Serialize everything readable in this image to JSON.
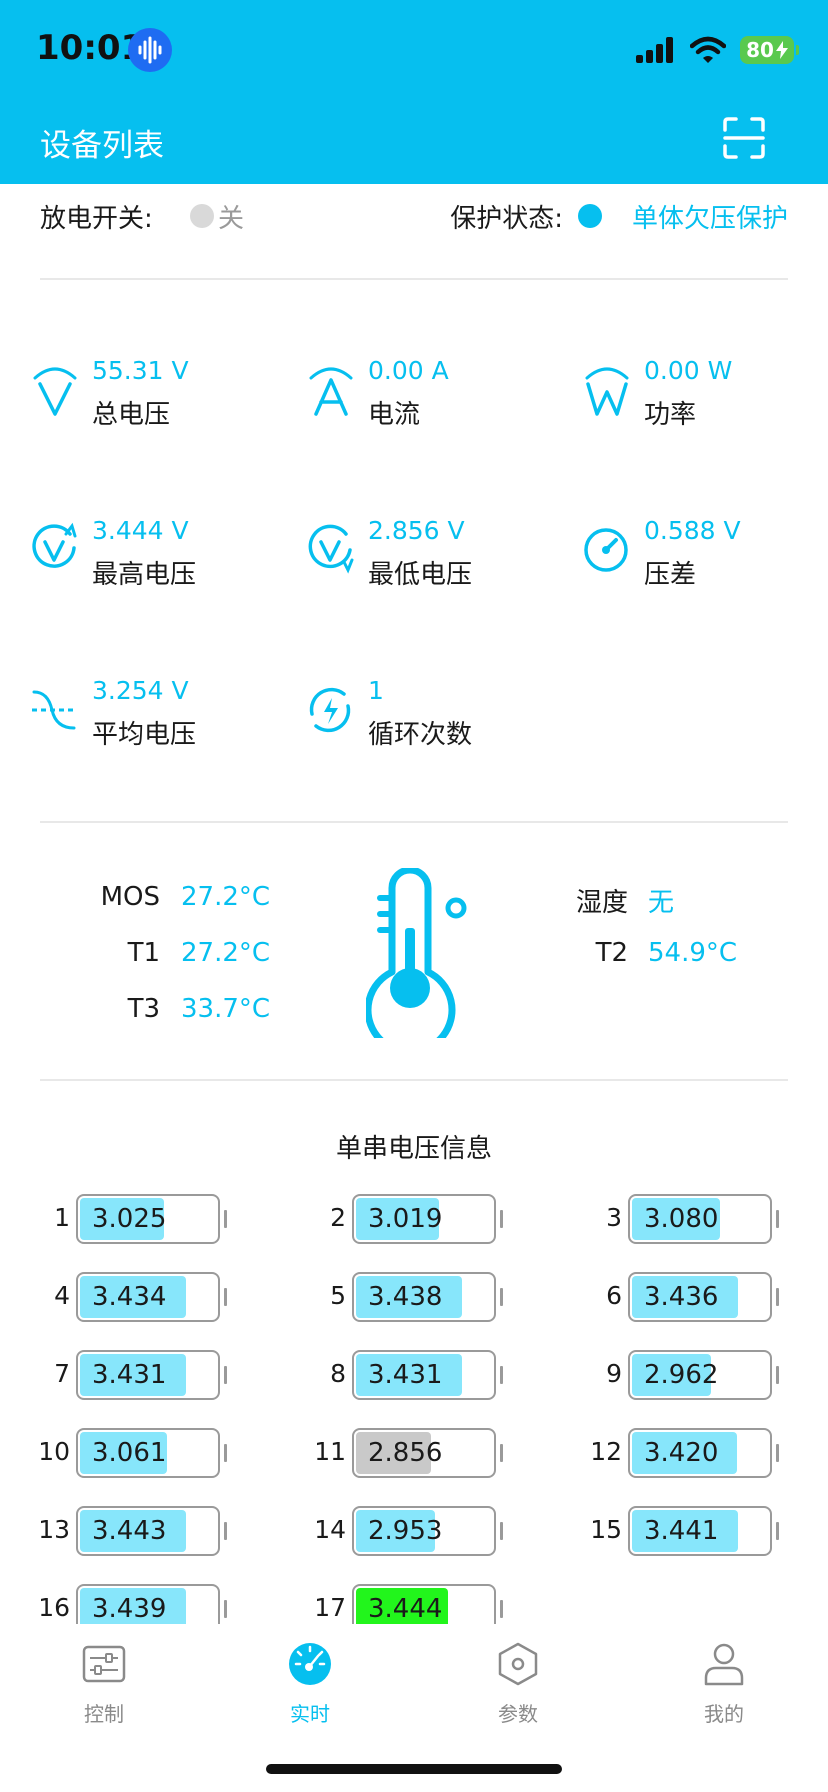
{
  "status_bar": {
    "time": "10:01",
    "battery": "80"
  },
  "header": {
    "title": "设备列表"
  },
  "status": {
    "discharge_label": "放电开关:",
    "discharge_value": "关",
    "protect_label": "保护状态:",
    "protect_value": "单体欠压保护"
  },
  "metrics": [
    {
      "value": "55.31 V",
      "label": "总电压",
      "icon": "voltage-icon"
    },
    {
      "value": "0.00 A",
      "label": "电流",
      "icon": "current-icon"
    },
    {
      "value": "0.00 W",
      "label": "功率",
      "icon": "power-icon"
    },
    {
      "value": "3.444 V",
      "label": "最高电压",
      "icon": "max-voltage-icon"
    },
    {
      "value": "2.856 V",
      "label": "最低电压",
      "icon": "min-voltage-icon"
    },
    {
      "value": "0.588 V",
      "label": "压差",
      "icon": "gauge-icon"
    },
    {
      "value": "3.254 V",
      "label": "平均电压",
      "icon": "average-voltage-icon"
    },
    {
      "value": "1",
      "label": "循环次数",
      "icon": "cycle-icon"
    }
  ],
  "temps": {
    "mos_label": "MOS",
    "mos_value": "27.2°C",
    "t1_label": "T1",
    "t1_value": "27.2°C",
    "t3_label": "T3",
    "t3_value": "33.7°C",
    "humidity_label": "湿度",
    "humidity_value": "无",
    "t2_label": "T2",
    "t2_value": "54.9°C"
  },
  "cells_title": "单串电压信息",
  "cells": [
    {
      "num": "1",
      "value": "3.025",
      "level": 0.62,
      "state": "normal"
    },
    {
      "num": "2",
      "value": "3.019",
      "level": 0.61,
      "state": "normal"
    },
    {
      "num": "3",
      "value": "3.080",
      "level": 0.65,
      "state": "normal"
    },
    {
      "num": "4",
      "value": "3.434",
      "level": 0.78,
      "state": "normal"
    },
    {
      "num": "5",
      "value": "3.438",
      "level": 0.78,
      "state": "normal"
    },
    {
      "num": "6",
      "value": "3.436",
      "level": 0.78,
      "state": "normal"
    },
    {
      "num": "7",
      "value": "3.431",
      "level": 0.78,
      "state": "normal"
    },
    {
      "num": "8",
      "value": "3.431",
      "level": 0.78,
      "state": "normal"
    },
    {
      "num": "9",
      "value": "2.962",
      "level": 0.58,
      "state": "normal"
    },
    {
      "num": "10",
      "value": "3.061",
      "level": 0.64,
      "state": "normal"
    },
    {
      "num": "11",
      "value": "2.856",
      "level": 0.55,
      "state": "min"
    },
    {
      "num": "12",
      "value": "3.420",
      "level": 0.77,
      "state": "normal"
    },
    {
      "num": "13",
      "value": "3.443",
      "level": 0.78,
      "state": "normal"
    },
    {
      "num": "14",
      "value": "2.953",
      "level": 0.58,
      "state": "normal"
    },
    {
      "num": "15",
      "value": "3.441",
      "level": 0.78,
      "state": "normal"
    },
    {
      "num": "16",
      "value": "3.439",
      "level": 0.78,
      "state": "normal"
    },
    {
      "num": "17",
      "value": "3.444",
      "level": 0.68,
      "state": "max"
    }
  ],
  "colors": {
    "accent": "#06bfef",
    "cell_normal": "#87e6fb",
    "cell_min": "#c9c9c9",
    "cell_max": "#22f51c",
    "tab_inactive": "#8a8a8a"
  },
  "tabs": [
    {
      "label": "控制",
      "icon": "control-icon",
      "active": false
    },
    {
      "label": "实时",
      "icon": "dashboard-icon",
      "active": true
    },
    {
      "label": "参数",
      "icon": "settings-hex-icon",
      "active": false
    },
    {
      "label": "我的",
      "icon": "user-icon",
      "active": false
    }
  ]
}
